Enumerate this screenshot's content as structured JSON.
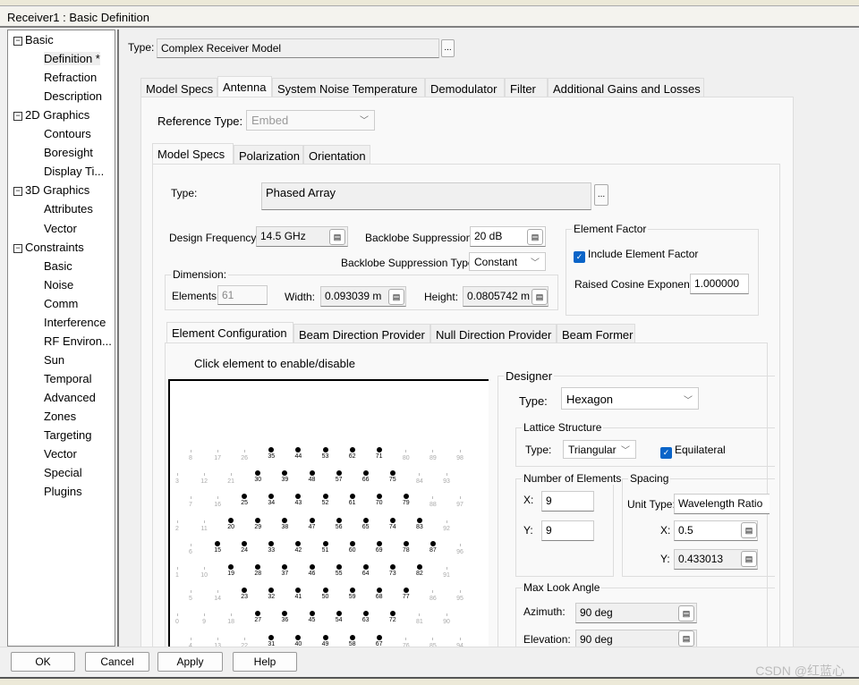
{
  "window": {
    "title": "Receiver1 : Basic Definition"
  },
  "tree": [
    {
      "label": "Basic",
      "level": 0
    },
    {
      "label": "Definition *",
      "level": 1,
      "selected": true
    },
    {
      "label": "Refraction",
      "level": 1
    },
    {
      "label": "Description",
      "level": 1
    },
    {
      "label": "2D Graphics",
      "level": 0
    },
    {
      "label": "Contours",
      "level": 1
    },
    {
      "label": "Boresight",
      "level": 1
    },
    {
      "label": "Display Ti...",
      "level": 1
    },
    {
      "label": "3D Graphics",
      "level": 0
    },
    {
      "label": "Attributes",
      "level": 1
    },
    {
      "label": "Vector",
      "level": 1
    },
    {
      "label": "Constraints",
      "level": 0
    },
    {
      "label": "Basic",
      "level": 1
    },
    {
      "label": "Noise",
      "level": 1
    },
    {
      "label": "Comm",
      "level": 1
    },
    {
      "label": "Interference",
      "level": 1
    },
    {
      "label": "RF Environ...",
      "level": 1
    },
    {
      "label": "Sun",
      "level": 1
    },
    {
      "label": "Temporal",
      "level": 1
    },
    {
      "label": "Advanced",
      "level": 1
    },
    {
      "label": "Zones",
      "level": 1
    },
    {
      "label": "Targeting",
      "level": 1
    },
    {
      "label": "Vector",
      "level": 1
    },
    {
      "label": "Special",
      "level": 1
    },
    {
      "label": "Plugins",
      "level": 1
    }
  ],
  "main": {
    "type_label": "Type:",
    "type_value": "Complex Receiver Model",
    "browse": "...",
    "tabs": [
      "Model Specs",
      "Antenna",
      "System Noise Temperature",
      "Demodulator",
      "Filter",
      "Additional Gains and Losses"
    ],
    "active_tab": "Antenna",
    "antenna": {
      "ref_type_label": "Reference Type:",
      "ref_type_value": "Embed",
      "tabs": [
        "Model Specs",
        "Polarization",
        "Orientation"
      ],
      "type_label": "Type:",
      "type_value": "Phased Array",
      "browse": "...",
      "design_freq_label": "Design Frequency:",
      "design_freq": "14.5 GHz",
      "backlobe_label": "Backlobe Suppression:",
      "backlobe": "20 dB",
      "backlobe_type_label": "Backlobe Suppression Type:",
      "backlobe_type": "Constant",
      "dimension_title": "Dimension:",
      "elements_label": "Elements:",
      "elements": "61",
      "width_label": "Width:",
      "width": "0.093039 m",
      "height_label": "Height:",
      "height": "0.0805742 m",
      "element_factor_title": "Element Factor",
      "include_ef_label": "Include Element Factor",
      "include_ef": true,
      "rce_label": "Raised Cosine Exponent:",
      "rce": "1.000000",
      "sub_tabs": [
        "Element Configuration",
        "Beam Direction Provider",
        "Null Direction Provider",
        "Beam Former"
      ],
      "instruction": "Click element to enable/disable",
      "designer": {
        "title": "Designer",
        "type_label": "Type:",
        "type": "Hexagon",
        "lattice_title": "Lattice Structure",
        "lattice_type_label": "Type:",
        "lattice_type": "Triangular",
        "equilateral_label": "Equilateral",
        "equilateral": true,
        "num_title": "Number of Elements",
        "x_label": "X:",
        "x": "9",
        "y_label": "Y:",
        "y": "9",
        "spacing_title": "Spacing",
        "unit_type_label": "Unit Type:",
        "unit_type": "Wavelength Ratio",
        "sx_label": "X:",
        "sx": "0.5",
        "sy_label": "Y:",
        "sy": "0.433013",
        "max_look_title": "Max Look Angle",
        "az_label": "Azimuth:",
        "az": "90 deg",
        "el_label": "Elevation:",
        "el": "90 deg"
      }
    }
  },
  "element_grid": {
    "rows": [
      {
        "labels": [
          8,
          17,
          26,
          35,
          44,
          53,
          62,
          71,
          80,
          89,
          98
        ],
        "active": [
          35,
          44,
          53,
          62,
          71
        ]
      },
      {
        "labels": [
          3,
          12,
          21,
          30,
          39,
          48,
          57,
          66,
          75,
          84,
          93
        ],
        "active": [
          30,
          39,
          48,
          57,
          66,
          75
        ]
      },
      {
        "labels": [
          7,
          16,
          25,
          34,
          43,
          52,
          61,
          70,
          79,
          88,
          97
        ],
        "active": [
          25,
          34,
          43,
          52,
          61,
          70,
          79
        ]
      },
      {
        "labels": [
          2,
          11,
          20,
          29,
          38,
          47,
          56,
          65,
          74,
          83,
          92
        ],
        "active": [
          20,
          29,
          38,
          47,
          56,
          65,
          74,
          83
        ]
      },
      {
        "labels": [
          6,
          15,
          24,
          33,
          42,
          51,
          60,
          69,
          78,
          87,
          96
        ],
        "active": [
          15,
          24,
          33,
          42,
          51,
          60,
          69,
          78,
          87
        ]
      },
      {
        "labels": [
          1,
          10,
          19,
          28,
          37,
          46,
          55,
          64,
          73,
          82,
          91
        ],
        "active": [
          19,
          28,
          37,
          46,
          55,
          64,
          73,
          82
        ]
      },
      {
        "labels": [
          5,
          14,
          23,
          32,
          41,
          50,
          59,
          68,
          77,
          86,
          95
        ],
        "active": [
          23,
          32,
          41,
          50,
          59,
          68,
          77
        ]
      },
      {
        "labels": [
          0,
          9,
          18,
          27,
          36,
          45,
          54,
          63,
          72,
          81,
          90
        ],
        "active": [
          27,
          36,
          45,
          54,
          63,
          72
        ]
      },
      {
        "labels": [
          4,
          13,
          22,
          31,
          40,
          49,
          58,
          67,
          76,
          85,
          94
        ],
        "active": [
          31,
          40,
          49,
          58,
          67
        ]
      }
    ]
  },
  "buttons": {
    "ok": "OK",
    "cancel": "Cancel",
    "apply": "Apply",
    "help": "Help"
  },
  "watermark": "CSDN @红蓝心"
}
